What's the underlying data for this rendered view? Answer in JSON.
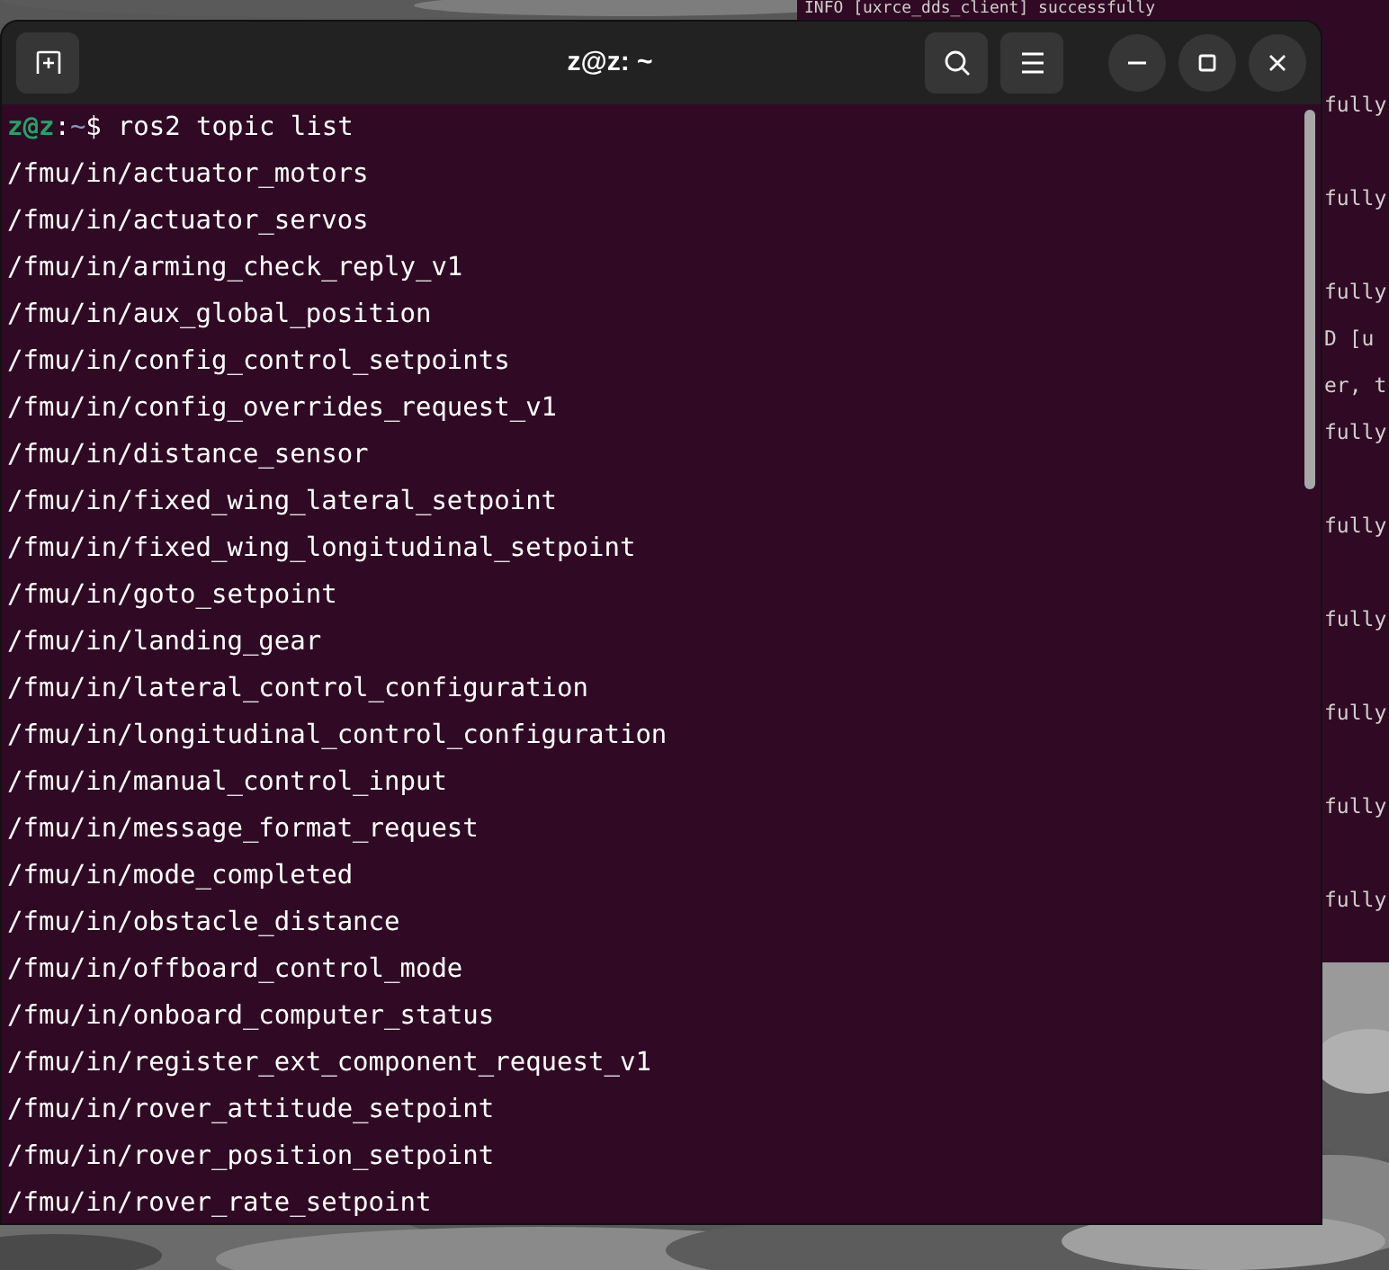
{
  "background_terminal": {
    "lines": [
      {
        "kind": "text",
        "text": "INFO  [uxrce_dds_client] successfully"
      },
      {
        "kind": "blank"
      },
      {
        "kind": "text",
        "text": "fully"
      },
      {
        "kind": "blank"
      },
      {
        "kind": "text",
        "text": "fully"
      },
      {
        "kind": "blank"
      },
      {
        "kind": "text",
        "text": "fully"
      },
      {
        "kind": "text",
        "text": "D  [u"
      },
      {
        "kind": "text",
        "text": "er, t"
      },
      {
        "kind": "text",
        "text": "fully"
      },
      {
        "kind": "blank"
      },
      {
        "kind": "text",
        "text": "fully"
      },
      {
        "kind": "blank"
      },
      {
        "kind": "text",
        "text": "fully"
      },
      {
        "kind": "blank"
      },
      {
        "kind": "text",
        "text": "fully"
      },
      {
        "kind": "blank"
      },
      {
        "kind": "text",
        "text": "fully"
      },
      {
        "kind": "blank"
      },
      {
        "kind": "text",
        "text": "fully"
      }
    ]
  },
  "window": {
    "title": "z@z: ~"
  },
  "prompt": {
    "user_host": "z@z",
    "separator": ":",
    "path": "~",
    "symbol": "$",
    "command": "ros2 topic list"
  },
  "output": [
    "/fmu/in/actuator_motors",
    "/fmu/in/actuator_servos",
    "/fmu/in/arming_check_reply_v1",
    "/fmu/in/aux_global_position",
    "/fmu/in/config_control_setpoints",
    "/fmu/in/config_overrides_request_v1",
    "/fmu/in/distance_sensor",
    "/fmu/in/fixed_wing_lateral_setpoint",
    "/fmu/in/fixed_wing_longitudinal_setpoint",
    "/fmu/in/goto_setpoint",
    "/fmu/in/landing_gear",
    "/fmu/in/lateral_control_configuration",
    "/fmu/in/longitudinal_control_configuration",
    "/fmu/in/manual_control_input",
    "/fmu/in/message_format_request",
    "/fmu/in/mode_completed",
    "/fmu/in/obstacle_distance",
    "/fmu/in/offboard_control_mode",
    "/fmu/in/onboard_computer_status",
    "/fmu/in/register_ext_component_request_v1",
    "/fmu/in/rover_attitude_setpoint",
    "/fmu/in/rover_position_setpoint",
    "/fmu/in/rover_rate_setpoint"
  ]
}
